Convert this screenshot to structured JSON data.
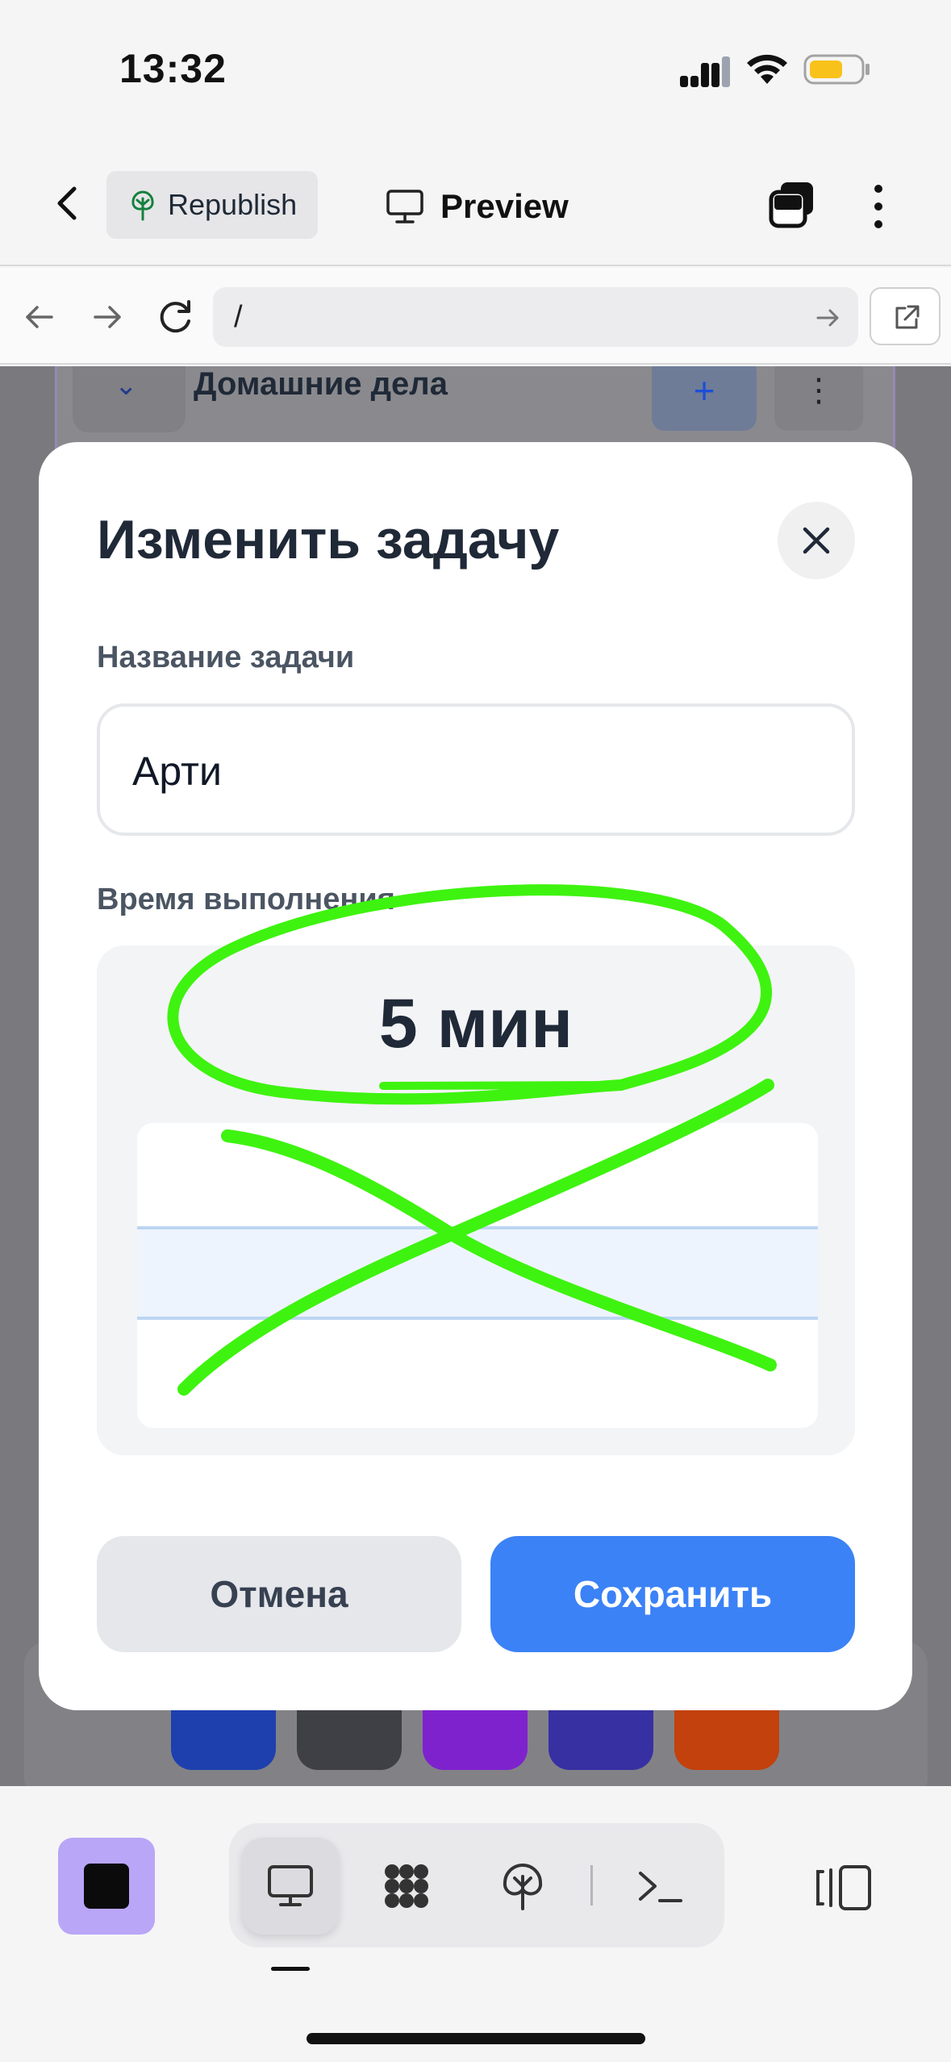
{
  "status_bar": {
    "time": "13:32",
    "battery_color": "#f8c21a"
  },
  "toolbar": {
    "republish_label": "Republish",
    "preview_label": "Preview"
  },
  "address_bar": {
    "url": "/"
  },
  "background": {
    "section_title": "Домашние дела",
    "plus_glyph": "+",
    "more_glyph": "⋮",
    "action_colors": [
      "#1e40af",
      "#3f3f46",
      "#7e22ce",
      "#3730a3",
      "#c2410c"
    ]
  },
  "modal": {
    "title": "Изменить задачу",
    "name_label": "Название задачи",
    "name_value": "Арти",
    "time_label": "Время выполнения",
    "time_value": "5 мин",
    "cancel_label": "Отмена",
    "save_label": "Сохранить"
  },
  "annotations": {
    "color": "#3ef30f",
    "marks": [
      "circle-around-time-value",
      "cross-over-picker"
    ]
  },
  "bottom_bar": {
    "tools": [
      "monitor-icon",
      "network-icon",
      "tree-icon",
      "terminal-icon"
    ],
    "active_tool": "monitor-icon",
    "stop_color": "#b9a6f7"
  }
}
